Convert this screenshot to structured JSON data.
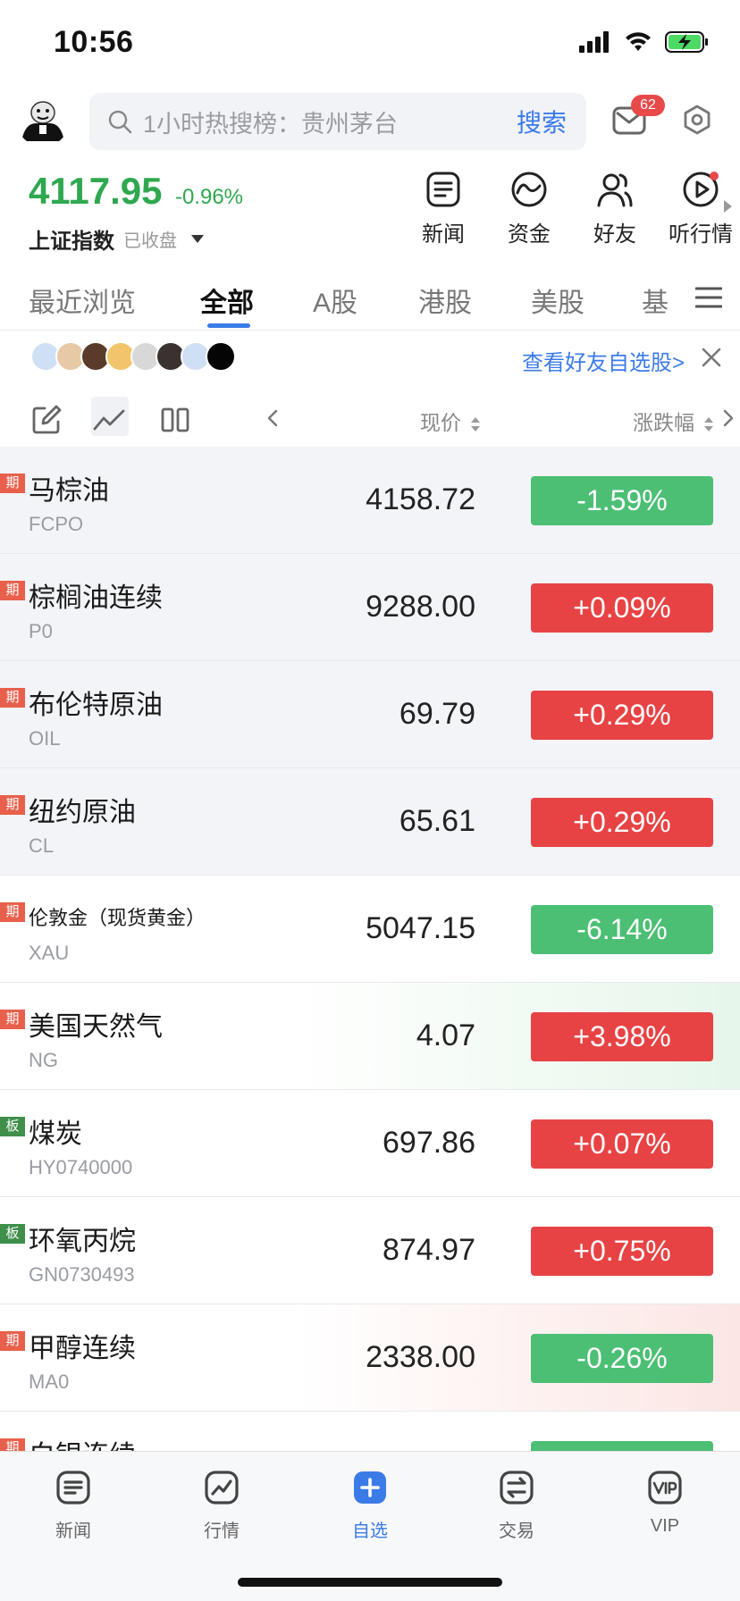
{
  "status_bar": {
    "time": "10:56",
    "icons": [
      "signal-icon",
      "wifi-icon",
      "battery-charging-icon"
    ]
  },
  "header": {
    "search_placeholder": "1小时热搜榜：贵州茅台",
    "search_button": "搜索",
    "message_badge": "62",
    "icons": [
      "avatar",
      "search-icon",
      "message-icon",
      "settings-icon"
    ]
  },
  "index": {
    "value": "4117.95",
    "change": "-0.96%",
    "name": "上证指数",
    "status": "已收盘"
  },
  "quick_actions": [
    {
      "label": "新闻",
      "icon": "news-icon"
    },
    {
      "label": "资金",
      "icon": "fund-flow-icon"
    },
    {
      "label": "好友",
      "icon": "friends-icon"
    },
    {
      "label": "听行情",
      "icon": "play-audio-icon"
    }
  ],
  "tabs": [
    {
      "label": "最近浏览",
      "active": false
    },
    {
      "label": "全部",
      "active": true
    },
    {
      "label": "A股",
      "active": false
    },
    {
      "label": "港股",
      "active": false
    },
    {
      "label": "美股",
      "active": false
    },
    {
      "label": "基",
      "active": false
    }
  ],
  "friends_bar": {
    "link": "查看好友自选股>"
  },
  "list_header": {
    "price_col": "现价",
    "change_col": "涨跌幅"
  },
  "rows": [
    {
      "tag": "期",
      "tag_type": "futures",
      "name": "马棕油",
      "code": "FCPO",
      "price": "4158.72",
      "change": "-1.59%",
      "direction": "down"
    },
    {
      "tag": "期",
      "tag_type": "futures",
      "name": "棕榈油连续",
      "code": "P0",
      "price": "9288.00",
      "change": "+0.09%",
      "direction": "up"
    },
    {
      "tag": "期",
      "tag_type": "futures",
      "name": "布伦特原油",
      "code": "OIL",
      "price": "69.79",
      "change": "+0.29%",
      "direction": "up"
    },
    {
      "tag": "期",
      "tag_type": "futures",
      "name": "纽约原油",
      "code": "CL",
      "price": "65.61",
      "change": "+0.29%",
      "direction": "up"
    },
    {
      "tag": "期",
      "tag_type": "futures",
      "name": "伦敦金（现货黄金）",
      "code": "XAU",
      "price": "5047.15",
      "change": "-6.14%",
      "direction": "down"
    },
    {
      "tag": "期",
      "tag_type": "futures",
      "name": "美国天然气",
      "code": "NG",
      "price": "4.07",
      "change": "+3.98%",
      "direction": "up"
    },
    {
      "tag": "板",
      "tag_type": "sector",
      "name": "煤炭",
      "code": "HY0740000",
      "price": "697.86",
      "change": "+0.07%",
      "direction": "up"
    },
    {
      "tag": "板",
      "tag_type": "sector",
      "name": "环氧丙烷",
      "code": "GN0730493",
      "price": "874.97",
      "change": "+0.75%",
      "direction": "up"
    },
    {
      "tag": "期",
      "tag_type": "futures",
      "name": "甲醇连续",
      "code": "MA0",
      "price": "2338.00",
      "change": "-0.26%",
      "direction": "down"
    },
    {
      "tag": "期",
      "tag_type": "futures",
      "name": "白银连续",
      "code": "",
      "price": "",
      "change": "",
      "direction": "down"
    }
  ],
  "bottom_nav": [
    {
      "label": "新闻",
      "icon": "news-tab-icon",
      "active": false
    },
    {
      "label": "行情",
      "icon": "market-tab-icon",
      "active": false
    },
    {
      "label": "自选",
      "icon": "watchlist-tab-icon",
      "active": true
    },
    {
      "label": "交易",
      "icon": "trade-tab-icon",
      "active": false
    },
    {
      "label": "VIP",
      "icon": "vip-tab-icon",
      "active": false
    }
  ],
  "colors": {
    "accent": "#3b7be8",
    "up": "#e84344",
    "down": "#4cbf74",
    "index_green": "#2fa84f"
  }
}
